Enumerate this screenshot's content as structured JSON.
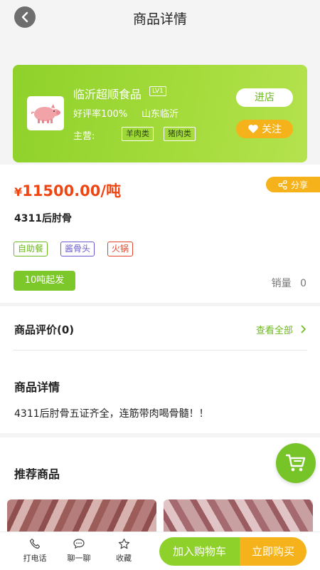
{
  "header": {
    "title": "商品详情"
  },
  "store": {
    "name": "临沂超顺食品",
    "level": "LV1",
    "rating": "好评率100%",
    "location": "山东临沂",
    "main_label": "主营:",
    "categories": [
      "羊肉类",
      "猪肉类"
    ],
    "enter_label": "进店",
    "follow_label": "关注",
    "logo_icon": "pig-icon"
  },
  "product": {
    "currency": "¥",
    "price": "11500.00/吨",
    "share_label": "分享",
    "name": "4311后肘骨",
    "tags": [
      {
        "label": "自助餐",
        "color": "#6db81e"
      },
      {
        "label": "酱骨头",
        "color": "#6a5acd"
      },
      {
        "label": "火锅",
        "color": "#e0442a"
      }
    ],
    "moq": "10吨起发",
    "sales_label": "销量",
    "sales_value": "0"
  },
  "reviews": {
    "title": "商品评价(0)",
    "view_all": "查看全部"
  },
  "detail": {
    "title": "商品详情",
    "text": "4311后肘骨五证齐全，连筋带肉喝骨髓！！"
  },
  "recommend": {
    "title": "推荐商品"
  },
  "bottom_bar": {
    "call_label": "打电话",
    "chat_label": "聊一聊",
    "fav_label": "收藏",
    "add_cart_label": "加入购物车",
    "buy_now_label": "立即购买"
  },
  "colors": {
    "accent_green": "#8fd12b",
    "accent_orange": "#f5b21b",
    "price_red": "#ee4613"
  }
}
